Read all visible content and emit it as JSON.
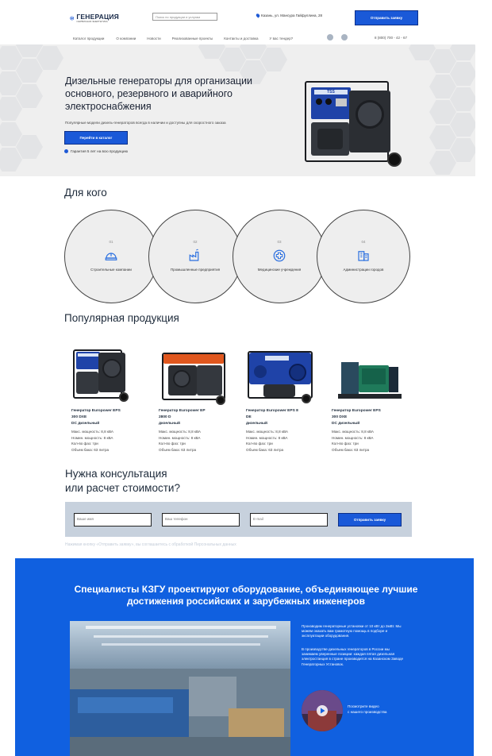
{
  "header": {
    "logo_title": "ГЕНЕРАЦИЯ",
    "logo_sub": "СЕРВИСНАЯ ЭНЕРГЕТИКА",
    "search_placeholder": "Поиск по продукции и услугам",
    "address": "Казань, ул. Мансура Гайфуллина, 28",
    "send_button": "Отправить заявку"
  },
  "nav": {
    "items": [
      "Каталог продукции",
      "О компании",
      "Новости",
      "Реализованные проекты",
      "Контакты и доставка",
      "У вас тендер?"
    ],
    "phone": "8 (800) 700 - 42 - 67"
  },
  "hero": {
    "title": "Дизельные генераторы для организации основного, резервного и аварийного электроснабжения",
    "subtitle": "Популярные модели дизель-генераторов всегда в наличии и доступны для скоростного заказа",
    "button": "Перейти в каталог",
    "warranty": "Гарантия 5 лет на всю продукцию"
  },
  "for_whom": {
    "title": "Для кого",
    "items": [
      {
        "num": "01",
        "label": "Строительные компании",
        "icon": "helmet-icon"
      },
      {
        "num": "02",
        "label": "Промышленные предприятия",
        "icon": "factory-icon"
      },
      {
        "num": "03",
        "label": "Медицинские учреждения",
        "icon": "medical-cross-icon"
      },
      {
        "num": "04",
        "label": "Администрации городов",
        "icon": "city-building-icon"
      }
    ]
  },
  "products": {
    "title": "Популярная продукция",
    "items": [
      {
        "name_lines": [
          "Генератор Europower EPS",
          "300 DXE",
          "DC дизельный"
        ],
        "specs": [
          "Макс. мощность: 8,8 кВА",
          "Номин. мощность: 8 кВА",
          "Кол-во фаз: три",
          "Объем бака: 63 литра"
        ],
        "accent": "#1f43a8"
      },
      {
        "name_lines": [
          "Генератор Europower EP",
          "2800 D",
          "дизельный"
        ],
        "specs": [
          "Макс. мощность: 8,8 кВА",
          "Номин. мощность: 8 кВА",
          "Кол-во фаз: три",
          "Объем бака: 63 литра"
        ],
        "accent": "#e0571e"
      },
      {
        "name_lines": [
          "Генератор Europower EPS 8",
          "DE",
          "дизельный"
        ],
        "specs": [
          "Макс. мощность: 8,8 кВА",
          "Номин. мощность: 8 кВА",
          "Кол-во фаз: три",
          "Объем бака: 63 литра"
        ],
        "accent": "#1f43a8"
      },
      {
        "name_lines": [
          "Генератор Europower EPS",
          "300 DXE",
          "DC дизельный"
        ],
        "specs": [
          "Макс. мощность: 8,8 кВА",
          "Номин. мощность: 8 кВА",
          "Кол-во фаз: три",
          "Объем бака: 63 литра"
        ],
        "accent": "#1f7a5a"
      }
    ]
  },
  "consult": {
    "title_line1": "Нужна консультация",
    "title_line2": "или расчет стоимости?",
    "name_placeholder": "Ваше имя",
    "phone_placeholder": "Ваш телефон",
    "email_placeholder": "E-mail",
    "button": "Отправить заявку",
    "consent": "Нажимая кнопку «Отправить заявку», вы соглашаетесь с обработкой Персональных данных"
  },
  "about": {
    "title": "Специалисты КЗГУ проектируют оборудование, объединяющее лучшие достижения российских и зарубежных инженеров",
    "para1": "Производим генераторные установки от 10 кВт до 2мВт. Мы можем оказать вам грамотную помощь в подборе и эксплуатации оборудования.",
    "para2": "В производстве дизельных генераторов в России мы занимаем уверенные позиции: каждая пятая дизельная электростанция в стране производится на Казанском Заводе Генераторных Установок.",
    "video_line1": "Посмотрите видео",
    "video_line2": "с нашего производства"
  }
}
